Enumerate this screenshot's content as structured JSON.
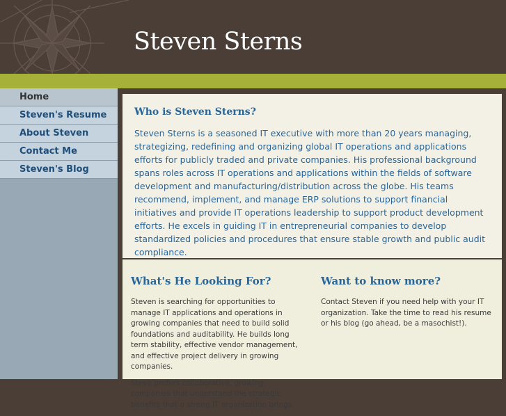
{
  "site": {
    "title": "Steven Sterns"
  },
  "nav": {
    "items": [
      {
        "label": "Home"
      },
      {
        "label": "Steven's Resume"
      },
      {
        "label": "About Steven"
      },
      {
        "label": "Contact Me"
      },
      {
        "label": "Steven's Blog"
      }
    ]
  },
  "who": {
    "heading": "Who is Steven Sterns?",
    "body": "Steven Sterns is a seasoned IT executive with more than 20 years managing, strategizing, redefining and organizing global IT operations and applications efforts for publicly traded and private companies.  His professional background spans roles across IT operations and applications within the fields of software development and manufacturing/distribution across the globe.  His teams recommend, implement, and manage ERP solutions to support financial initiatives and provide IT operations leadership to support product development efforts.   He excels in guiding IT in entrepreneurial companies to develop standardized policies and procedures that ensure stable growth and public audit compliance."
  },
  "looking": {
    "heading": "What's He Looking For?",
    "para1": "Steven is searching for opportunities to manage IT applications and operations in growing companies that need to build solid foundations and auditability.  He builds long term stability, effective vendor management, and effective project delivery in growing companies.",
    "para2": "Steve prefers collaborative, growing companies that understand the strategic benefits that a strong IT organization brings."
  },
  "more": {
    "heading": "Want to know more?",
    "body": "Contact Steven if you need help with your IT organization.  Take the time to read his resume or his blog (go ahead, be a masochist!)."
  },
  "colors": {
    "header_bg": "#4a3e37",
    "accent_green": "#a6b13a",
    "link_blue": "#2a6597",
    "sidebar_bg": "#98a8b4"
  }
}
